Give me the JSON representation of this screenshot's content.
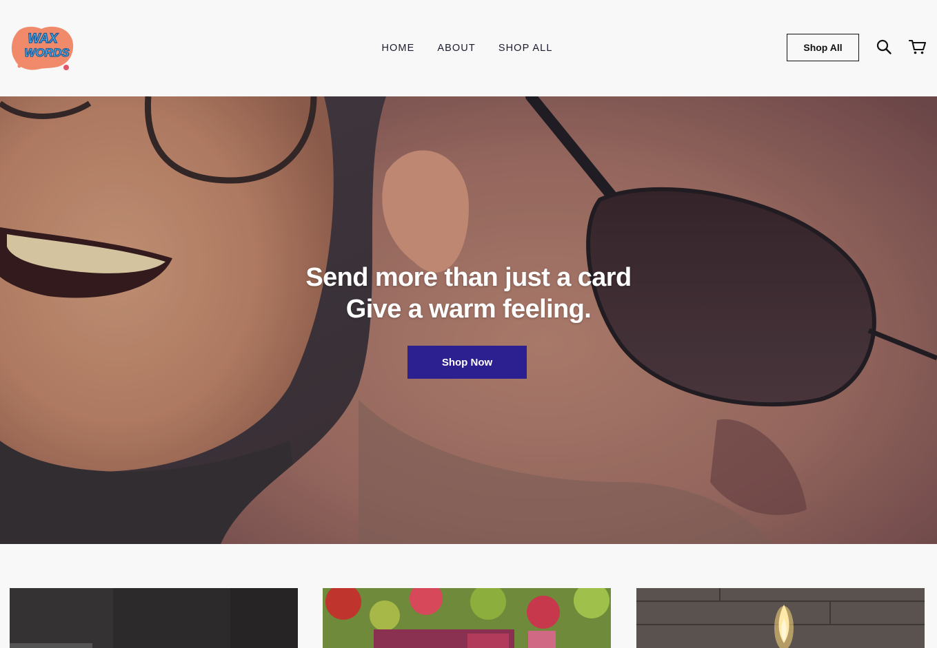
{
  "brand": {
    "logo_line1": "WAX",
    "logo_line2": "WORDS",
    "logo_colors": {
      "blob": "#f08a6a",
      "text_fill": "#5cc6ee",
      "text_stroke": "#1d5a9c"
    }
  },
  "nav": {
    "items": [
      {
        "label": "HOME"
      },
      {
        "label": "ABOUT"
      },
      {
        "label": "SHOP ALL"
      }
    ]
  },
  "header": {
    "shop_all_label": "Shop All",
    "search_icon": "search-icon",
    "cart_icon": "cart-icon"
  },
  "hero": {
    "headline_line1": "Send more than just a card",
    "headline_line2": "Give a warm feeling.",
    "cta_label": "Shop Now",
    "cta_color": "#2c1f8f"
  },
  "products": [
    {
      "image": "dark-candle-photo"
    },
    {
      "image": "floral-candle-photo"
    },
    {
      "image": "lit-candle-on-wood-photo"
    }
  ]
}
